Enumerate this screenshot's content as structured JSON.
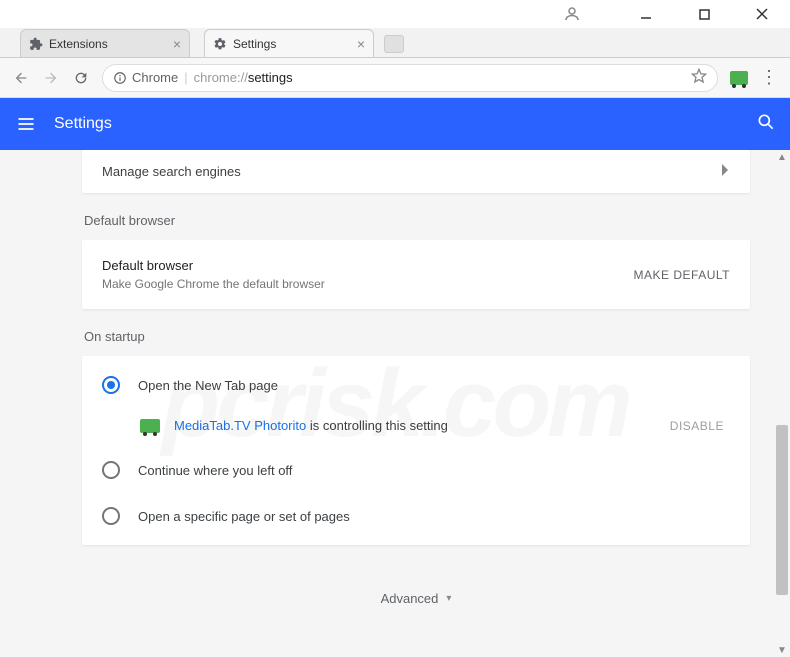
{
  "window": {
    "tabs": [
      {
        "label": "Extensions",
        "active": false
      },
      {
        "label": "Settings",
        "active": true
      }
    ]
  },
  "omnibox": {
    "origin_label": "Chrome",
    "url_host": "chrome://",
    "url_path": "settings"
  },
  "header": {
    "title": "Settings"
  },
  "search_engines": {
    "manage_label": "Manage search engines"
  },
  "default_browser": {
    "section_label": "Default browser",
    "title": "Default browser",
    "subtitle": "Make Google Chrome the default browser",
    "button": "MAKE DEFAULT"
  },
  "on_startup": {
    "section_label": "On startup",
    "options": [
      "Open the New Tab page",
      "Continue where you left off",
      "Open a specific page or set of pages"
    ],
    "controlled_by": {
      "extension_name": "MediaTab.TV Photorito",
      "message": "is controlling this setting",
      "disable_label": "DISABLE"
    }
  },
  "advanced": {
    "label": "Advanced"
  },
  "watermark": "pcrisk.com"
}
